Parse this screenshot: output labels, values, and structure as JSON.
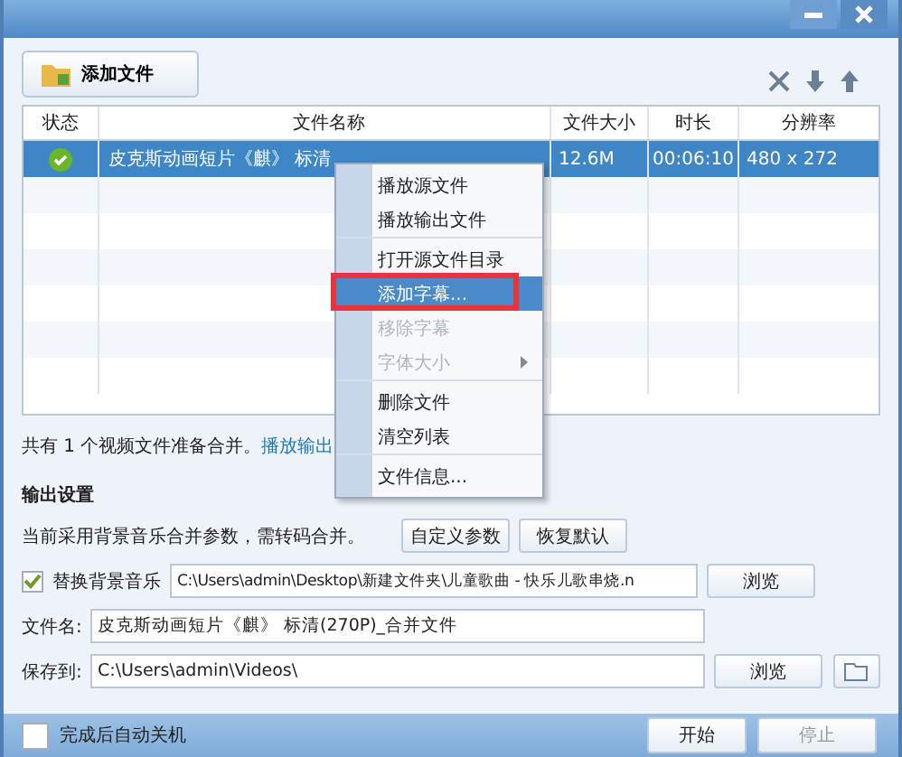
{
  "toolbar": {
    "add_button": "添加文件"
  },
  "table": {
    "columns": [
      "状态",
      "文件名称",
      "文件大小",
      "时长",
      "分辨率"
    ],
    "rows": [
      {
        "selected": true,
        "done": true,
        "file_name": "皮克斯动画短片《麒》 标清",
        "size": "12.6M",
        "duration": "00:06:10",
        "resolution": "480 x 272"
      }
    ]
  },
  "context_menu": {
    "items": [
      {
        "label": "播放源文件",
        "disabled": false,
        "selected": false,
        "submenu": false,
        "separator_after": false
      },
      {
        "label": "播放输出文件",
        "disabled": false,
        "selected": false,
        "submenu": false,
        "separator_after": true
      },
      {
        "label": "打开源文件目录",
        "disabled": false,
        "selected": false,
        "submenu": false,
        "separator_after": false
      },
      {
        "label": "添加字幕...",
        "disabled": false,
        "selected": true,
        "submenu": false,
        "separator_after": false
      },
      {
        "label": "移除字幕",
        "disabled": true,
        "selected": false,
        "submenu": false,
        "separator_after": false
      },
      {
        "label": "字体大小",
        "disabled": true,
        "selected": false,
        "submenu": true,
        "separator_after": true
      },
      {
        "label": "删除文件",
        "disabled": false,
        "selected": false,
        "submenu": false,
        "separator_after": false
      },
      {
        "label": "清空列表",
        "disabled": false,
        "selected": false,
        "submenu": false,
        "separator_after": true
      },
      {
        "label": "文件信息...",
        "disabled": false,
        "selected": false,
        "submenu": false,
        "separator_after": false
      }
    ]
  },
  "summary": {
    "text": "共有 1 个视频文件准备合并。",
    "link": "播放输出"
  },
  "output": {
    "heading": "输出设置",
    "note": "当前采用背景音乐合并参数，需转码合并。",
    "custom_button": "自定义参数",
    "reset_button": "恢复默认",
    "bgm": {
      "checked": true,
      "label": "替换背景音乐",
      "value": "C:\\Users\\admin\\Desktop\\新建文件夹\\儿童歌曲 - 快乐儿歌串烧.n",
      "button": "浏览"
    },
    "filename": {
      "label": "文件名:",
      "value": "皮克斯动画短片《麒》 标清(270P)_合并文件"
    },
    "save": {
      "label": "保存到:",
      "value": "C:\\Users\\admin\\Videos\\",
      "button": "浏览"
    }
  },
  "footer": {
    "shutdown": {
      "checked": false,
      "label": "完成后自动关机"
    },
    "start_button": "开始",
    "stop": {
      "label": "停止",
      "disabled": true
    }
  }
}
